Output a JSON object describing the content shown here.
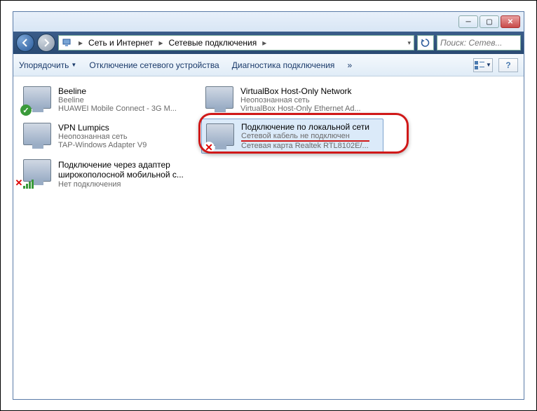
{
  "breadcrumb": {
    "root_icon": "network-icon",
    "part1": "Сеть и Интернет",
    "part2": "Сетевые подключения"
  },
  "search": {
    "placeholder": "Поиск: Сетев..."
  },
  "toolbar": {
    "organize": "Упорядочить",
    "disable": "Отключение сетевого устройства",
    "diagnose": "Диагностика подключения",
    "more": "»"
  },
  "items": [
    {
      "name": "Beeline",
      "sub1": "Beeline",
      "sub2": "HUAWEI Mobile Connect - 3G M...",
      "overlay": "ok"
    },
    {
      "name": "VirtualBox Host-Only Network",
      "sub1": "Неопознанная сеть",
      "sub2": "VirtualBox Host-Only Ethernet Ad...",
      "overlay": "none"
    },
    {
      "name": "VPN Lumpics",
      "sub1": "Неопознанная сеть",
      "sub2": "TAP-Windows Adapter V9",
      "overlay": "none"
    },
    {
      "name": "Подключение по локальной сети",
      "sub1": "Сетевой кабель не подключен",
      "sub2": "Сетевая карта Realtek RTL8102E/...",
      "overlay": "x",
      "selected": true
    },
    {
      "name": "Подключение через адаптер широкополосной мобильной с...",
      "sub1": "Нет подключения",
      "sub2": "",
      "overlay": "xbars"
    }
  ]
}
